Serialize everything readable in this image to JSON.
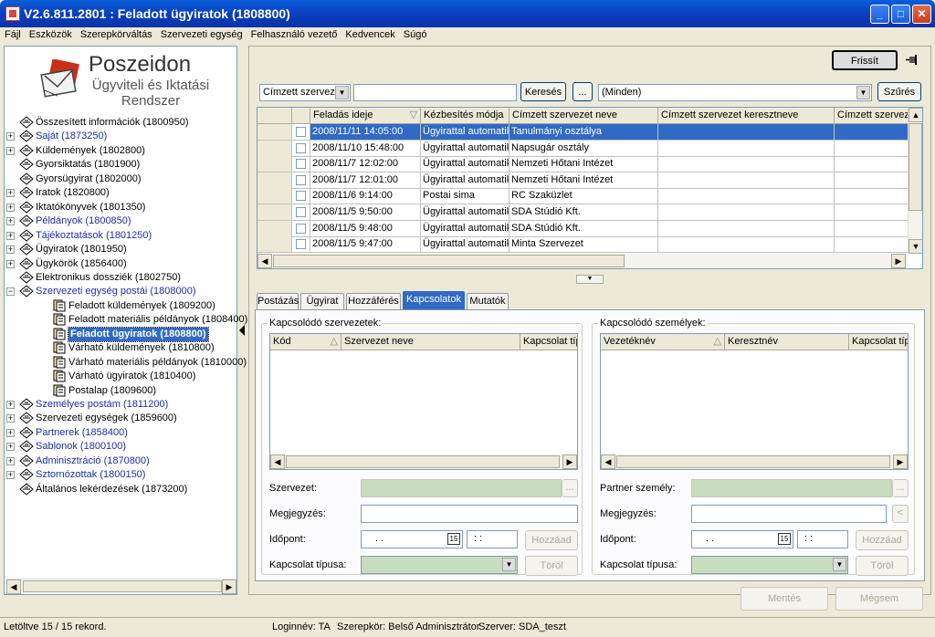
{
  "window": {
    "title": "V2.6.811.2801 : Feladott ügyiratok (1808800)",
    "min": "_",
    "max": "□",
    "close": "✕"
  },
  "menu": [
    "Fájl",
    "Eszközök",
    "Szerepkörváltás",
    "Szervezeti egység",
    "Felhasználó vezető",
    "Kedvencek",
    "Súgó"
  ],
  "logo": {
    "name": "Poszeidon",
    "sub1": "Ügyviteli és Iktatási",
    "sub2": "Rendszer"
  },
  "tree": [
    {
      "label": "Összesített információk (1800950)",
      "level": 0,
      "expand": "",
      "blue": false
    },
    {
      "label": "Saját (1873250)",
      "level": 0,
      "expand": "+",
      "blue": true
    },
    {
      "label": "Küldemények (1802800)",
      "level": 0,
      "expand": "+",
      "blue": false
    },
    {
      "label": "Gyorsiktatás (1801900)",
      "level": 0,
      "expand": "",
      "blue": false
    },
    {
      "label": "Gyorsügyirat (1802000)",
      "level": 0,
      "expand": "",
      "blue": false
    },
    {
      "label": "Iratok (1820800)",
      "level": 0,
      "expand": "+",
      "blue": false
    },
    {
      "label": "Iktatókönyvek (1801350)",
      "level": 0,
      "expand": "+",
      "blue": false
    },
    {
      "label": "Példányok (1800850)",
      "level": 0,
      "expand": "+",
      "blue": true
    },
    {
      "label": "Tájékoztatások (1801250)",
      "level": 0,
      "expand": "+",
      "blue": true
    },
    {
      "label": "Ügyiratok (1801950)",
      "level": 0,
      "expand": "+",
      "blue": false
    },
    {
      "label": "Ügykörök (1856400)",
      "level": 0,
      "expand": "+",
      "blue": false
    },
    {
      "label": "Elektronikus dossziék (1802750)",
      "level": 0,
      "expand": "",
      "blue": false
    },
    {
      "label": "Szervezeti egység postái (1808000)",
      "level": 0,
      "expand": "−",
      "blue": true
    },
    {
      "label": "Feladott küldemények (1809200)",
      "level": 1,
      "expand": "",
      "blue": false
    },
    {
      "label": "Feladott materiális példányok (1808400)",
      "level": 1,
      "expand": "",
      "blue": false
    },
    {
      "label": "Feladott ügyiratok (1808800)",
      "level": 1,
      "expand": "",
      "blue": false,
      "selected": true
    },
    {
      "label": "Várható küldemények (1810800)",
      "level": 1,
      "expand": "",
      "blue": false
    },
    {
      "label": "Várható materiális példányok (1810000)",
      "level": 1,
      "expand": "",
      "blue": false
    },
    {
      "label": "Várható ügyiratok (1810400)",
      "level": 1,
      "expand": "",
      "blue": false
    },
    {
      "label": "Postalap (1809600)",
      "level": 1,
      "expand": "",
      "blue": false
    },
    {
      "label": "Személyes postám (1811200)",
      "level": 0,
      "expand": "+",
      "blue": true
    },
    {
      "label": "Szervezeti egységek (1859600)",
      "level": 0,
      "expand": "+",
      "blue": false
    },
    {
      "label": "Partnerek (1858400)",
      "level": 0,
      "expand": "+",
      "blue": true
    },
    {
      "label": "Sablonok (1800100)",
      "level": 0,
      "expand": "+",
      "blue": true
    },
    {
      "label": "Adminisztráció (1870800)",
      "level": 0,
      "expand": "+",
      "blue": true
    },
    {
      "label": "Sztornózottak (1800150)",
      "level": 0,
      "expand": "+",
      "blue": true
    },
    {
      "label": "Általános lekérdezések (1873200)",
      "level": 0,
      "expand": "",
      "blue": false
    }
  ],
  "toolbar": {
    "refresh": "Frissít",
    "pin_icon": "pin-icon"
  },
  "search": {
    "field_select": "Címzett szerveze",
    "value": "",
    "search_btn": "Keresés",
    "ellipsis": "...",
    "filter_select": "(Minden)",
    "filter_btn": "Szűrés"
  },
  "table": {
    "headers": [
      "Feladás ideje",
      "Kézbesítés módja",
      "Címzett szervezet neve",
      "Címzett szervezet keresztneve",
      "Címzett szerveze"
    ],
    "rows": [
      [
        "2008/11/11 14:05:00",
        "Ügyirattal automatiku",
        "Tanulmányi osztálya",
        "",
        ""
      ],
      [
        "2008/11/10 15:48:00",
        "Ügyirattal automatiku",
        "Napsugár osztály",
        "",
        ""
      ],
      [
        "2008/11/7 12:02:00",
        "Ügyirattal automatiku",
        "Nemzeti Hőtani Intézet",
        "",
        ""
      ],
      [
        "2008/11/7 12:01:00",
        "Ügyirattal automatiku",
        "Nemzeti Hőtani Intézet",
        "",
        ""
      ],
      [
        "2008/11/6 9:14:00",
        "Postai sima",
        "RC Szaküzlet",
        "",
        ""
      ],
      [
        "2008/11/5 9:50:00",
        "Ügyirattal automatiku",
        "SDA Stúdió Kft.",
        "",
        ""
      ],
      [
        "2008/11/5 9:48:00",
        "Ügyirattal automatiku",
        "SDA Stúdió Kft.",
        "",
        ""
      ],
      [
        "2008/11/5 9:47:00",
        "Ügyirattal automatiku",
        "Minta Szervezet",
        "",
        ""
      ]
    ]
  },
  "tabs": [
    "Postázás",
    "Ügyirat",
    "Hozzáférés",
    "Kapcsolatok",
    "Mutatók"
  ],
  "org_panel": {
    "title": "Kapcsolódó szervezetek:",
    "headers": [
      "Kód",
      "Szervezet neve",
      "Kapcsolat típu"
    ],
    "lbl_org": "Szervezet:",
    "lbl_note": "Megjegyzés:",
    "lbl_time": "Időpont:",
    "lbl_type": "Kapcsolat típusa:",
    "date": ". .",
    "time": ": :",
    "add": "Hozzáad",
    "delete": "Töröl",
    "ellipsis": "..."
  },
  "person_panel": {
    "title": "Kapcsolódó személyek:",
    "headers": [
      "Vezetéknév",
      "Keresztnév",
      "Kapcsolat típu"
    ],
    "lbl_partner": "Partner személy:",
    "lbl_note": "Megjegyzés:",
    "lbl_time": "Időpont:",
    "lbl_type": "Kapcsolat típusa:",
    "date": ". .",
    "time": ": :",
    "add": "Hozzáad",
    "delete": "Töröl",
    "ellipsis": "...",
    "lt": "<"
  },
  "footer": {
    "save": "Mentés",
    "cancel": "Mégsem"
  },
  "status": {
    "records": "Letöltve 15 / 15 rekord.",
    "login": "Loginnév: TA",
    "role": "Szerepkör: Belső Adminisztrátor",
    "server": "Szerver: SDA_teszt"
  }
}
